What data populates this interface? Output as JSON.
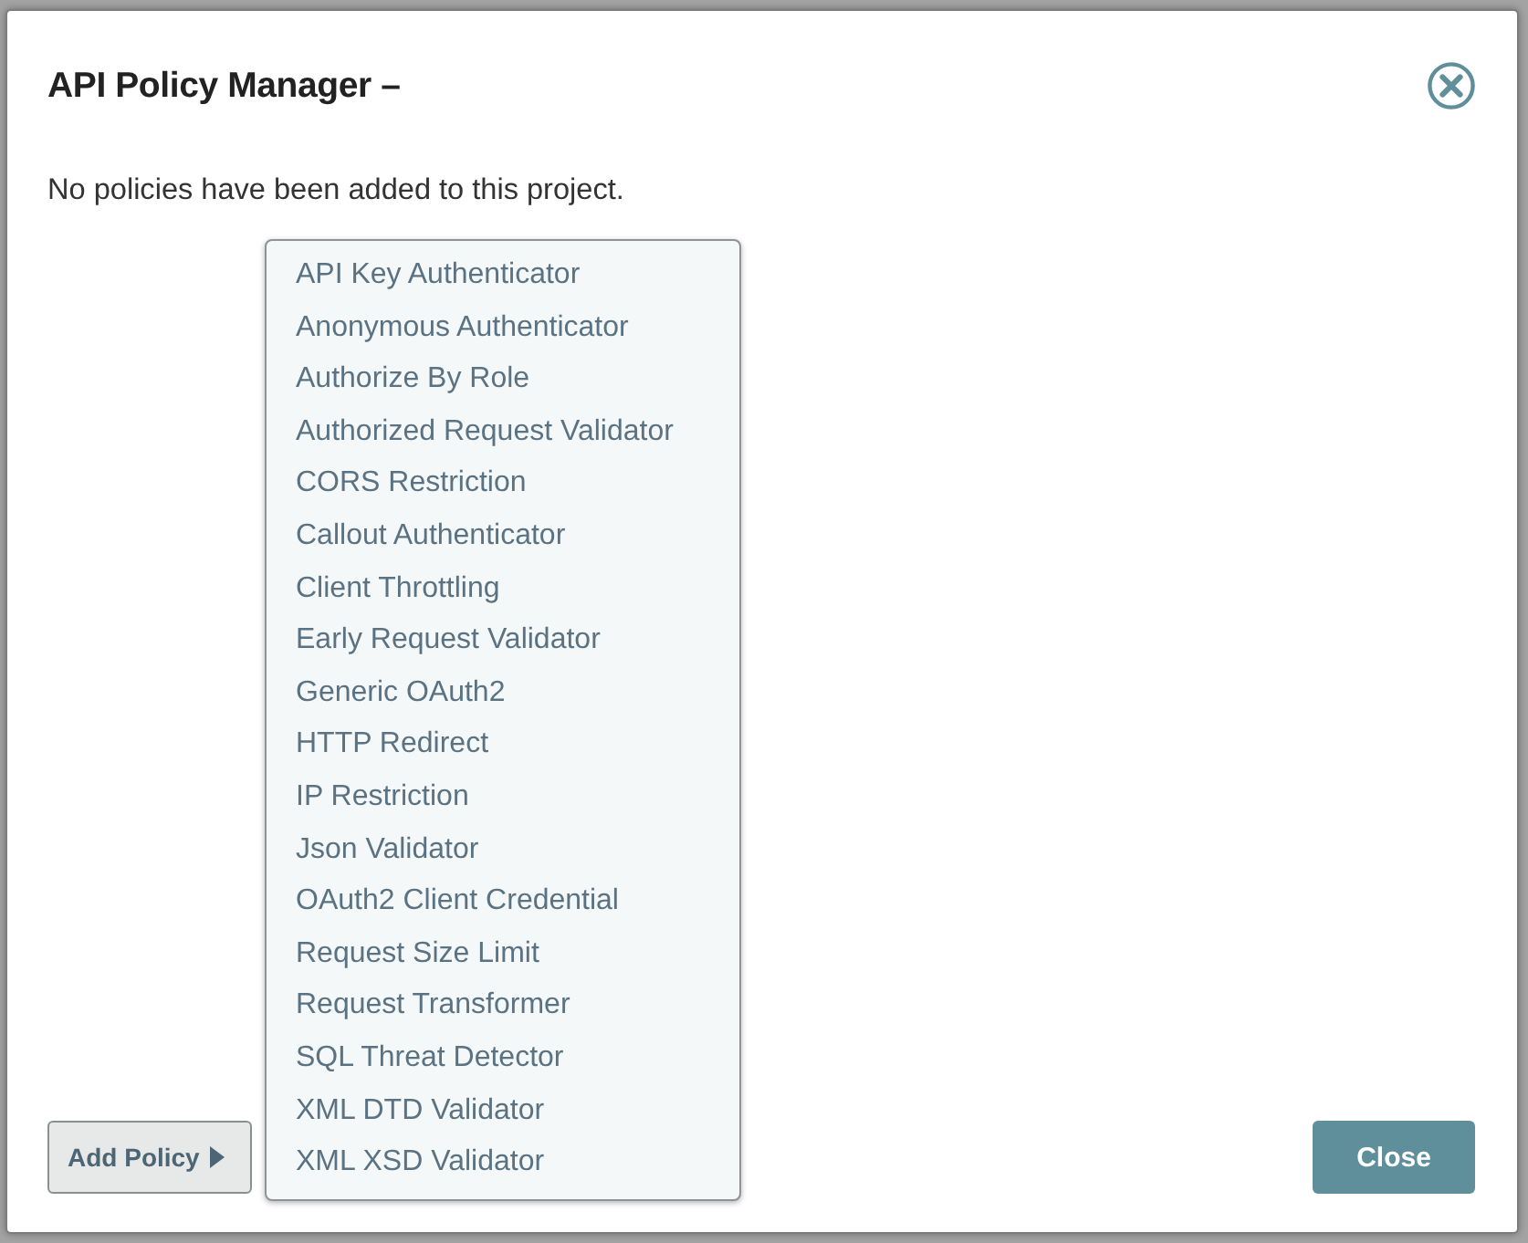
{
  "dialog": {
    "title": "API Policy Manager –",
    "message": "No policies have been added to this project.",
    "add_policy": {
      "label": "Add Policy",
      "expanded": true,
      "menu": [
        {
          "label": "API Key Authenticator"
        },
        {
          "label": "Anonymous Authenticator"
        },
        {
          "label": "Authorize By Role"
        },
        {
          "label": "Authorized Request Validator"
        },
        {
          "label": "CORS Restriction"
        },
        {
          "label": "Callout Authenticator"
        },
        {
          "label": "Client Throttling"
        },
        {
          "label": "Early Request Validator"
        },
        {
          "label": "Generic OAuth2"
        },
        {
          "label": "HTTP Redirect"
        },
        {
          "label": "IP Restriction"
        },
        {
          "label": "Json Validator"
        },
        {
          "label": "OAuth2 Client Credential"
        },
        {
          "label": "Request Size Limit"
        },
        {
          "label": "Request Transformer"
        },
        {
          "label": "SQL Threat Detector"
        },
        {
          "label": "XML DTD Validator"
        },
        {
          "label": "XML XSD Validator"
        }
      ]
    },
    "buttons": [
      {
        "label": "Close",
        "kind": "primary"
      }
    ]
  }
}
